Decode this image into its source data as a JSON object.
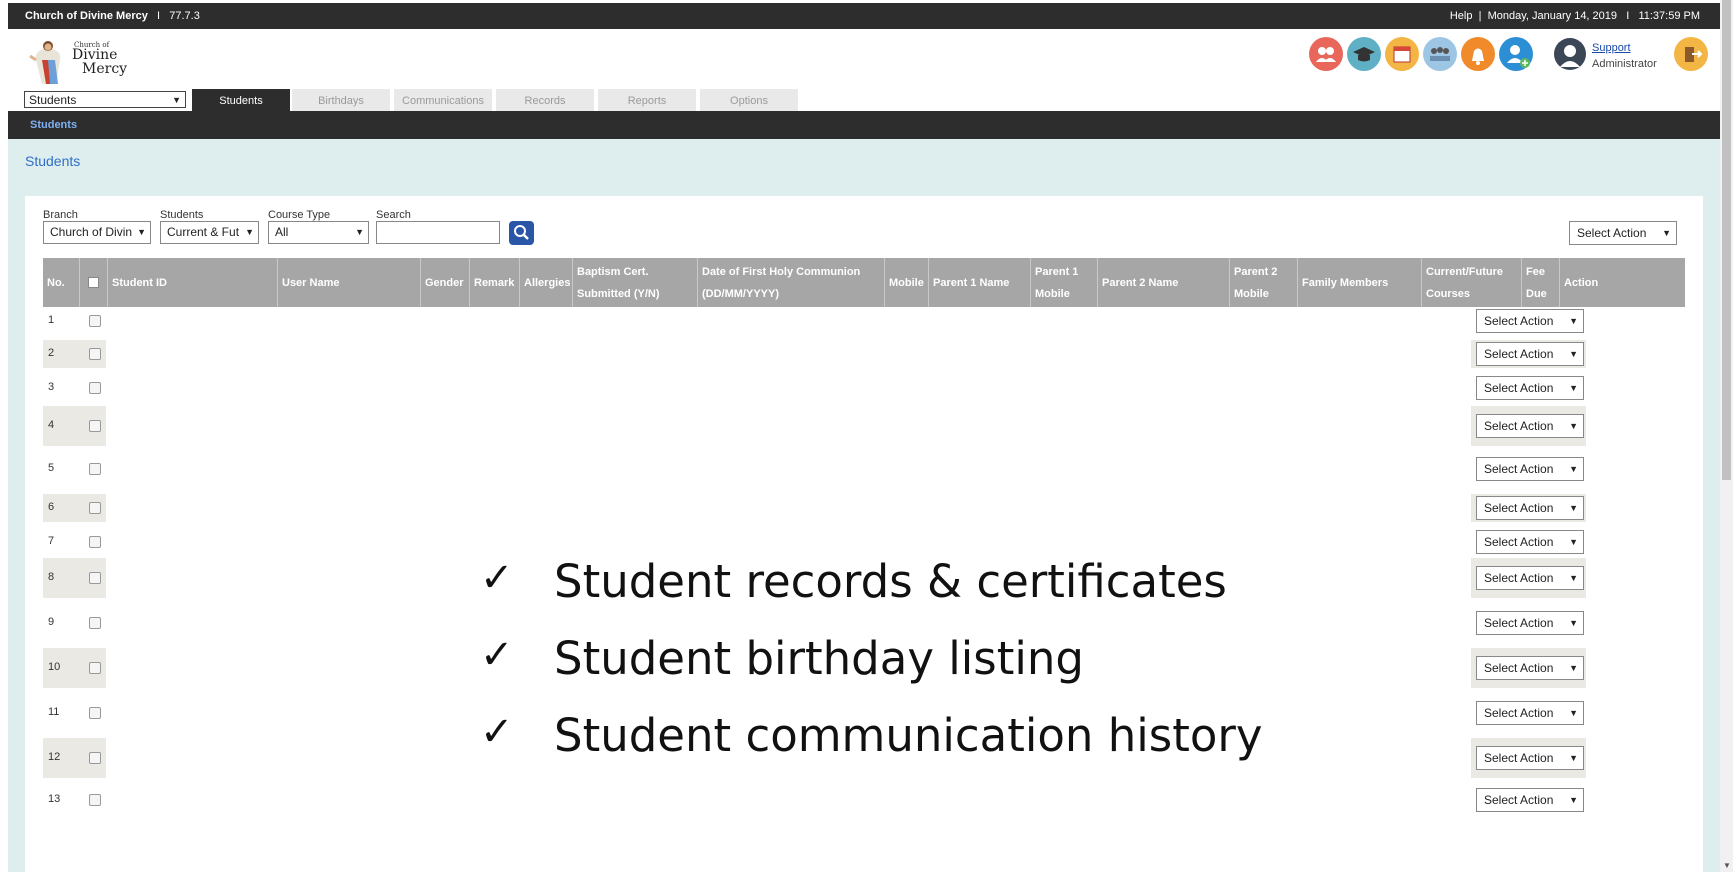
{
  "topbar": {
    "org": "Church of Divine Mercy",
    "sep": "I",
    "version": "77.7.3",
    "help": "Help",
    "datetime": "Monday, January 14, 2019",
    "time": "11:37:59 PM"
  },
  "logo": {
    "line1": "Church of",
    "line2": "Divine",
    "line3": "Mercy"
  },
  "module_select": {
    "value": "Students"
  },
  "tabs": [
    {
      "label": "Students"
    },
    {
      "label": "Birthdays"
    },
    {
      "label": "Communications"
    },
    {
      "label": "Records"
    },
    {
      "label": "Reports"
    },
    {
      "label": "Options"
    }
  ],
  "header_icons": [
    {
      "name": "parents-icon",
      "color": "#e8665a"
    },
    {
      "name": "graduation-icon",
      "color": "#5fb0c4"
    },
    {
      "name": "calendar-icon",
      "color": "#f3b544"
    },
    {
      "name": "classroom-icon",
      "color": "#9cc6e3"
    },
    {
      "name": "bell-icon",
      "color": "#f08a2a"
    },
    {
      "name": "add-user-icon",
      "color": "#2c8fd6"
    }
  ],
  "user": {
    "support": "Support",
    "role": "Administrator"
  },
  "subnav": {
    "label": "Students"
  },
  "page_title": "Students",
  "filters": {
    "branch_label": "Branch",
    "branch_value": "Church of Divin",
    "students_label": "Students",
    "students_value": "Current & Fut",
    "course_type_label": "Course Type",
    "course_type_value": "All",
    "search_label": "Search",
    "search_value": ""
  },
  "select_action": "Select Action",
  "columns": [
    "No.",
    "",
    "Student ID",
    "User Name",
    "Gender",
    "Remark",
    "Allergies",
    "Baptism Cert. Submitted (Y/N)",
    "Date of First Holy Communion (DD/MM/YYYY)",
    "Mobile",
    "Parent 1 Name",
    "Parent 1 Mobile",
    "Parent 2 Name",
    "Parent 2 Mobile",
    "Family Members",
    "Current/Future Courses",
    "Fee Due",
    "Action"
  ],
  "rows": [
    "1",
    "2",
    "3",
    "4",
    "5",
    "6",
    "7",
    "8",
    "9",
    "10",
    "11",
    "12",
    "13"
  ],
  "overlay": [
    "Student records & certificates",
    "Student birthday listing",
    "Student communication history"
  ],
  "check_glyph": "✓",
  "colors": {
    "dark": "#2d2d2d",
    "content_bg": "#deeded",
    "header_gray": "#a6a6a6",
    "title_blue": "#2f6fc8"
  }
}
